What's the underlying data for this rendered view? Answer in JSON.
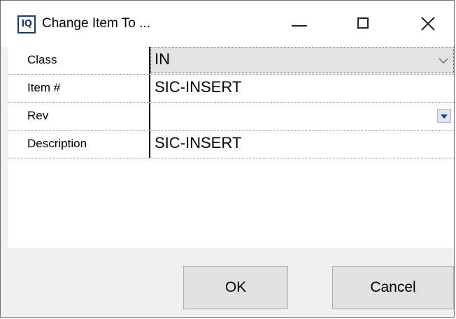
{
  "window": {
    "title": "Change Item To ...",
    "app_icon_text": "IQ"
  },
  "grid": {
    "rows": [
      {
        "label": "Class",
        "value": "IN",
        "editor": "dropdown"
      },
      {
        "label": "Item #",
        "value": "SIC-INSERT",
        "editor": "text"
      },
      {
        "label": "Rev",
        "value": "",
        "editor": "dropdown"
      },
      {
        "label": "Description",
        "value": "SIC-INSERT",
        "editor": "text"
      }
    ]
  },
  "buttons": {
    "ok_label": "OK",
    "cancel_label": "Cancel"
  },
  "icons": {
    "title_buttons": [
      "minimize-icon",
      "maximize-icon",
      "close-icon"
    ],
    "dropdowns": [
      "chevron-down-icon",
      "dropdown-arrow-icon"
    ]
  },
  "colors": {
    "app_icon": "#1f3a73",
    "selected_cell": "#e3e3e3",
    "dropdown_arrow": "#1040a8"
  }
}
